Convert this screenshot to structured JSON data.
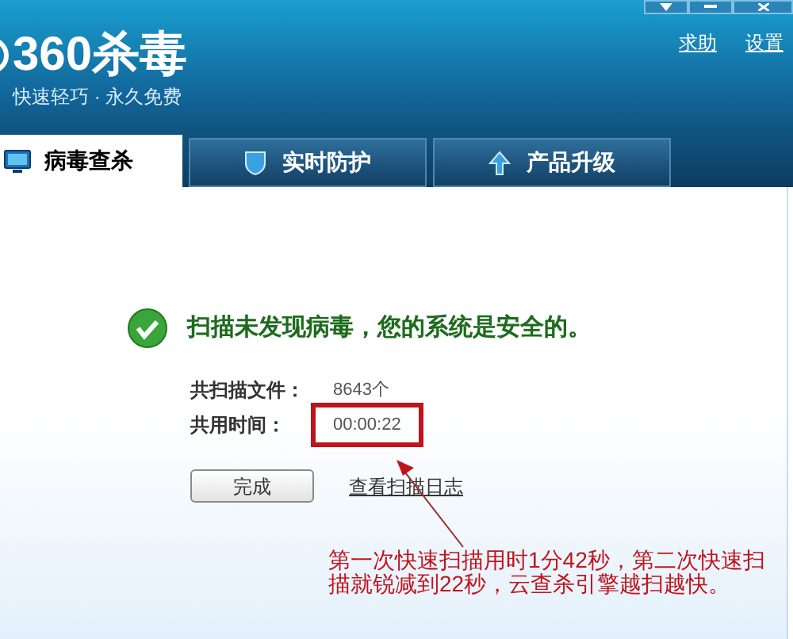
{
  "app": {
    "logo": "360杀毒",
    "slogan": "快速轻巧 · 永久免费"
  },
  "header_links": [
    "求助",
    "设置"
  ],
  "tabs": [
    {
      "label": "病毒查杀",
      "selected": true,
      "kind": "monitor"
    },
    {
      "label": "实时防护",
      "selected": false,
      "kind": "shield"
    },
    {
      "label": "产品升级",
      "selected": false,
      "kind": "upgrade"
    }
  ],
  "result": {
    "message": "扫描未发现病毒，您的系统是安全的。",
    "stats": [
      {
        "label": "共扫描文件：",
        "value": "8643个",
        "highlighted": false
      },
      {
        "label": "共用时间：",
        "value": "00:00:22",
        "highlighted": true
      }
    ],
    "done_button": "完成",
    "log_link": "查看扫描日志"
  },
  "annotation": "第一次快速扫描用时1分42秒，第二次快速扫描就锐减到22秒，云查杀引擎越扫越快。"
}
